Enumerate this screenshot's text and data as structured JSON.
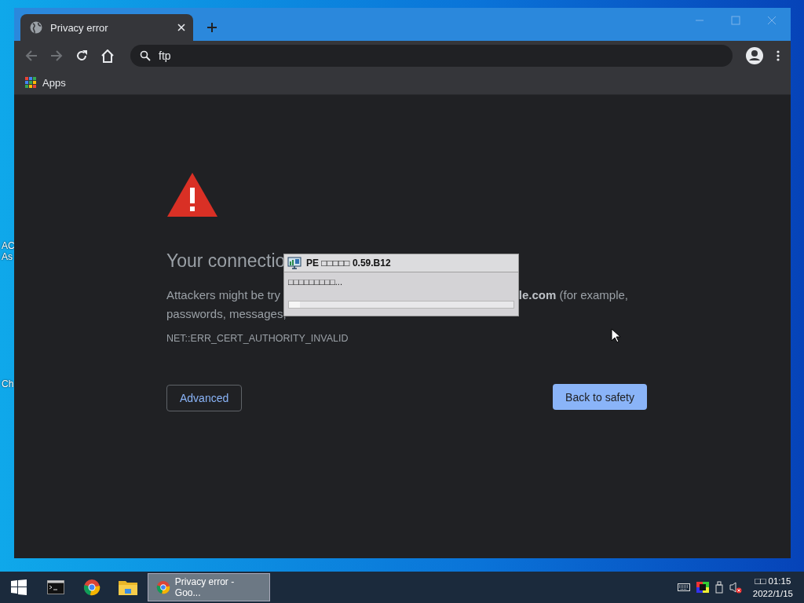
{
  "desktop": {
    "labels": [
      "AC",
      "As",
      "Ch"
    ]
  },
  "browser": {
    "tabs": [
      {
        "title": "Privacy error",
        "selected": true
      }
    ],
    "nav": {
      "back_disabled": true,
      "forward_disabled": true
    },
    "address": {
      "value": "ftp"
    },
    "bookmarks": [
      {
        "label": "Apps"
      }
    ]
  },
  "page": {
    "heading": "Your connectio",
    "line_1_left": "Attackers might be try",
    "line_1_right": "**le.com** (for example,",
    "line_2": "passwords, messages,",
    "error_code": "NET::ERR_CERT_AUTHORITY_INVALID",
    "buttons": [
      {
        "label": "Advanced",
        "kind": "secondary"
      },
      {
        "label": "Back to safety",
        "kind": "primary"
      }
    ]
  },
  "dialog": {
    "title": "PE □□□□□ 0.59.B12",
    "message": "□□□□□□□□□...",
    "progress": {
      "level": 0.05
    }
  },
  "taskbar": {
    "pinned": [
      {
        "kind": "terminal"
      },
      {
        "kind": "chrome"
      },
      {
        "kind": "folder"
      }
    ],
    "windows": [
      {
        "label": "Privacy error - Goo...",
        "selected": true
      }
    ],
    "clock": {
      "time": "□□ 01:15",
      "date": "2022/1/15"
    }
  }
}
